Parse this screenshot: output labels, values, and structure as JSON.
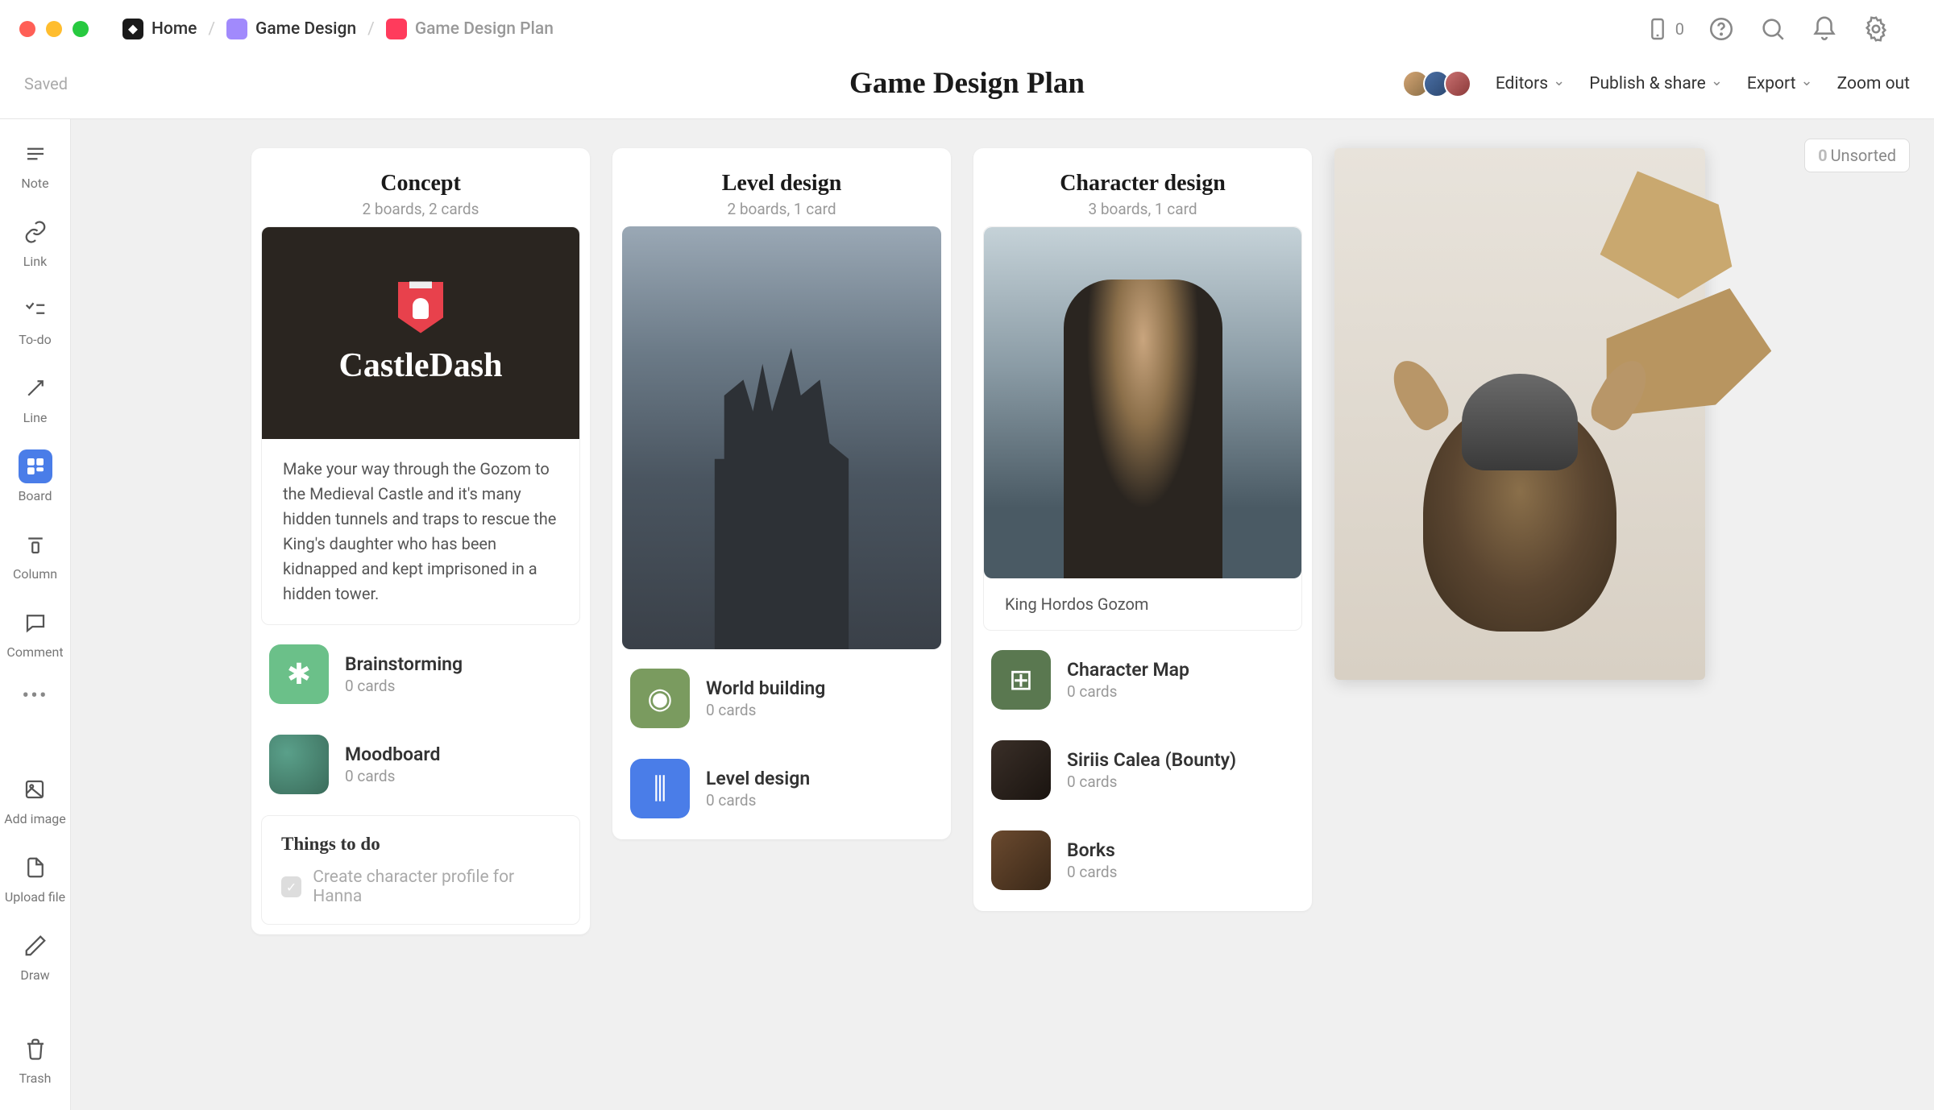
{
  "titlebar": {
    "breadcrumb": [
      {
        "label": "Home",
        "color": "dark"
      },
      {
        "label": "Game Design",
        "color": "purple"
      },
      {
        "label": "Game Design Plan",
        "color": "red"
      }
    ],
    "phone_count": "0"
  },
  "header": {
    "saved": "Saved",
    "title": "Game Design Plan",
    "editors": "Editors",
    "publish": "Publish & share",
    "export": "Export",
    "zoom": "Zoom out"
  },
  "sidebar": {
    "tools": [
      {
        "id": "note",
        "label": "Note"
      },
      {
        "id": "link",
        "label": "Link"
      },
      {
        "id": "todo",
        "label": "To-do"
      },
      {
        "id": "line",
        "label": "Line"
      },
      {
        "id": "board",
        "label": "Board",
        "active": true
      },
      {
        "id": "column",
        "label": "Column"
      },
      {
        "id": "comment",
        "label": "Comment"
      },
      {
        "id": "more",
        "label": ""
      },
      {
        "id": "addimage",
        "label": "Add image"
      },
      {
        "id": "upload",
        "label": "Upload file"
      },
      {
        "id": "draw",
        "label": "Draw"
      }
    ],
    "trash": "Trash"
  },
  "unsorted": {
    "count": "0",
    "label": "Unsorted"
  },
  "boards": [
    {
      "title": "Concept",
      "subtitle": "2 boards, 2 cards",
      "hero_title": "CastleDash",
      "description": "Make your way through the Gozom to the Medieval Castle and it's many hidden tunnels and traps to rescue the King's daughter who has been kidnapped and kept imprisoned in a hidden tower.",
      "links": [
        {
          "title": "Brainstorming",
          "sub": "0 cards",
          "icon": "ic-green"
        },
        {
          "title": "Moodboard",
          "sub": "0 cards",
          "icon": "ic-teal"
        }
      ],
      "todo": {
        "head": "Things to do",
        "item": "Create character profile for Hanna"
      }
    },
    {
      "title": "Level design",
      "subtitle": "2 boards, 1 card",
      "links": [
        {
          "title": "World building",
          "sub": "0 cards",
          "icon": "ic-olive"
        },
        {
          "title": "Level design",
          "sub": "0 cards",
          "icon": "ic-blue"
        }
      ]
    },
    {
      "title": "Character design",
      "subtitle": "3 boards, 1 card",
      "caption": "King Hordos Gozom",
      "links": [
        {
          "title": "Character Map",
          "sub": "0 cards",
          "icon": "ic-dgreen"
        },
        {
          "title": "Siriis Calea (Bounty)",
          "sub": "0 cards",
          "icon": "ic-dark"
        },
        {
          "title": "Borks",
          "sub": "0 cards",
          "icon": "ic-brown"
        }
      ]
    }
  ]
}
